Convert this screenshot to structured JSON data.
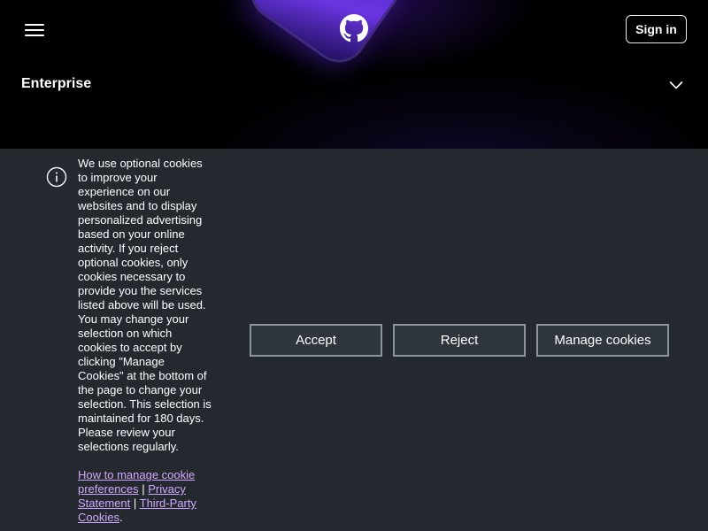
{
  "header": {
    "menu_icon": "hamburger-menu-icon",
    "logo_icon": "github-logo-icon",
    "sign_in_label": "Sign in"
  },
  "nav": {
    "enterprise_label": "Enterprise",
    "expand_icon": "chevron-down-icon"
  },
  "cookie_banner": {
    "info_icon": "info-icon",
    "message": "We use optional cookies to improve your experience on our websites and to display personalized advertising based on your online activity. If you reject optional cookies, only cookies necessary to provide you the services listed above will be used. You may change your selection on which cookies to accept by clicking \"Manage Cookies\" at the bottom of the page to change your selection. This selection is maintained for 180 days. Please review your selections regularly.",
    "links": {
      "manage_preferences": "How to manage cookie preferences",
      "separator1": " | ",
      "privacy_statement": "Privacy Statement",
      "separator2": " | ",
      "third_party": "Third-Party Cookies",
      "trailing": "."
    },
    "buttons": {
      "accept": "Accept",
      "reject": "Reject",
      "manage": "Manage cookies"
    }
  },
  "colors": {
    "background": "#24292f",
    "header_background": "#000000",
    "link": "#d2a8ff",
    "button_border": "#8c959f",
    "button_background": "#2f353d",
    "hero_accent": "#6a35e0"
  }
}
